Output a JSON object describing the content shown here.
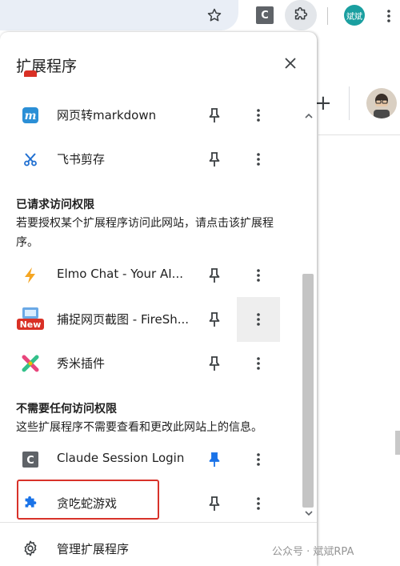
{
  "toolbar": {
    "star_icon": "star-icon",
    "claude_ext_letter": "C",
    "profile_label": "斌斌"
  },
  "panel": {
    "title": "扩展程序",
    "close_icon": "close-icon",
    "pinned_section": {
      "items": [
        {
          "name": "网页转markdown",
          "icon": "markdown-m-icon",
          "pinned": false
        },
        {
          "name": "飞书剪存",
          "icon": "scissors-icon",
          "pinned": false
        }
      ]
    },
    "requested_section": {
      "title": "已请求访问权限",
      "description": "若要授权某个扩展程序访问此网站，请点击该扩展程序。",
      "items": [
        {
          "name": "Elmo Chat - Your AI...",
          "icon": "lightning-icon",
          "pinned": false
        },
        {
          "name": "捕捉网页截图 - FireSh...",
          "icon": "fireshot-new-icon",
          "badge": "New",
          "pinned": false
        },
        {
          "name": "秀米插件",
          "icon": "xiumi-icon",
          "pinned": false
        }
      ]
    },
    "no_access_section": {
      "title": "不需要任何访问权限",
      "description": "这些扩展程序不需要查看和更改此网站上的信息。",
      "items": [
        {
          "name": "Claude Session Login",
          "icon": "claude-c-icon",
          "pinned": true
        },
        {
          "name": "贪吃蛇游戏",
          "icon": "puzzle-icon",
          "pinned": false
        }
      ]
    },
    "footer": {
      "label": "管理扩展程序",
      "icon": "gear-icon"
    }
  },
  "colors": {
    "pin_active": "#1a73e8",
    "highlight": "#d8322a",
    "accent_blue": "#1a73e8"
  },
  "watermark": "公众号 · 斌斌RPA"
}
